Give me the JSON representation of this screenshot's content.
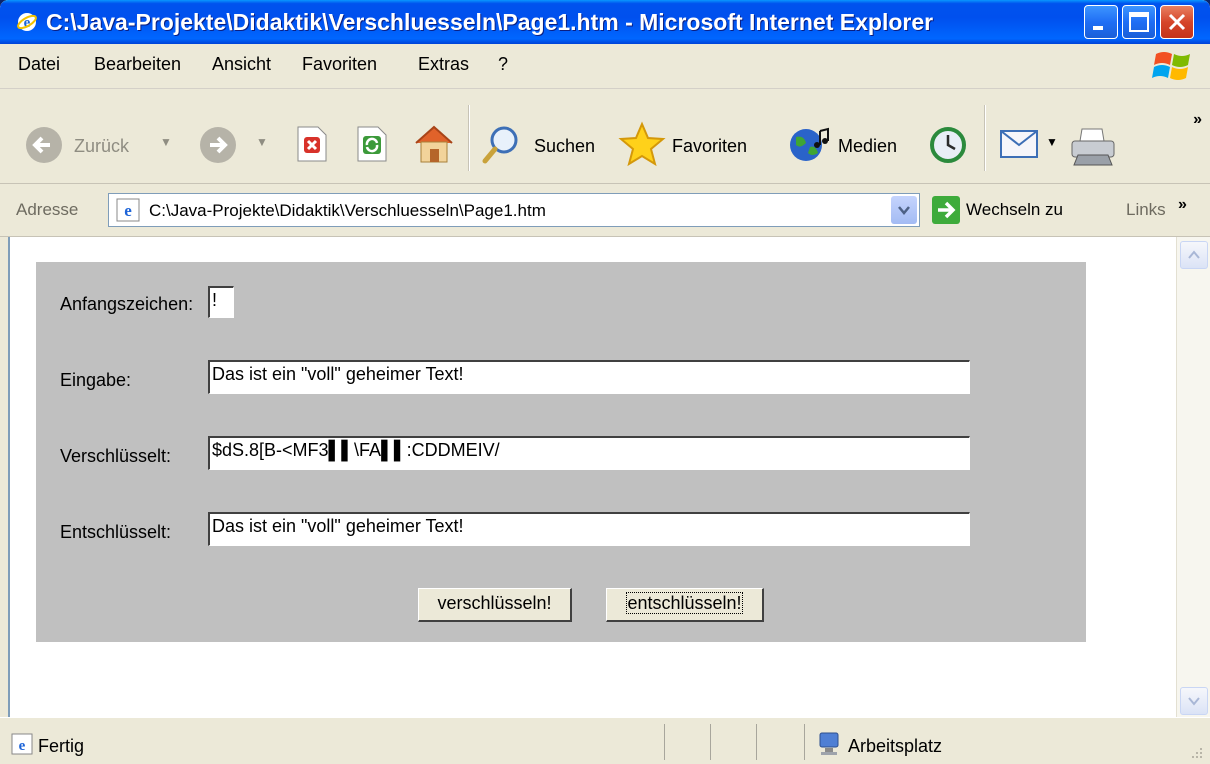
{
  "window": {
    "title": "C:\\Java-Projekte\\Didaktik\\Verschluesseln\\Page1.htm - Microsoft Internet Explorer"
  },
  "menu": {
    "items": [
      "Datei",
      "Bearbeiten",
      "Ansicht",
      "Favoriten",
      "Extras",
      "?"
    ]
  },
  "toolbar": {
    "back_label": "Zurück",
    "search_label": "Suchen",
    "favorites_label": "Favoriten",
    "media_label": "Medien"
  },
  "address": {
    "label": "Adresse",
    "url": "C:\\Java-Projekte\\Didaktik\\Verschluesseln\\Page1.htm",
    "go_label": "Wechseln zu",
    "links_label": "Links"
  },
  "form": {
    "start_char_label": "Anfangszeichen:",
    "start_char_value": "!",
    "input_label": "Eingabe:",
    "input_value": "Das ist ein \"voll\" geheimer Text!",
    "encrypted_label": "Verschlüsselt:",
    "encrypted_value": "$dS.8[B-<MF3▌▌\\FA▌▌:CDDMEIV/",
    "decrypted_label": "Entschlüsselt:",
    "decrypted_value": "Das ist ein \"voll\" geheimer Text!",
    "encrypt_button": "verschlüsseln!",
    "decrypt_button": "entschlüsseln!"
  },
  "status": {
    "text": "Fertig",
    "zone": "Arbeitsplatz"
  },
  "colors": {
    "titlebar": "#0054e3",
    "chrome": "#ece9d8",
    "panel": "#c0c0c0"
  }
}
